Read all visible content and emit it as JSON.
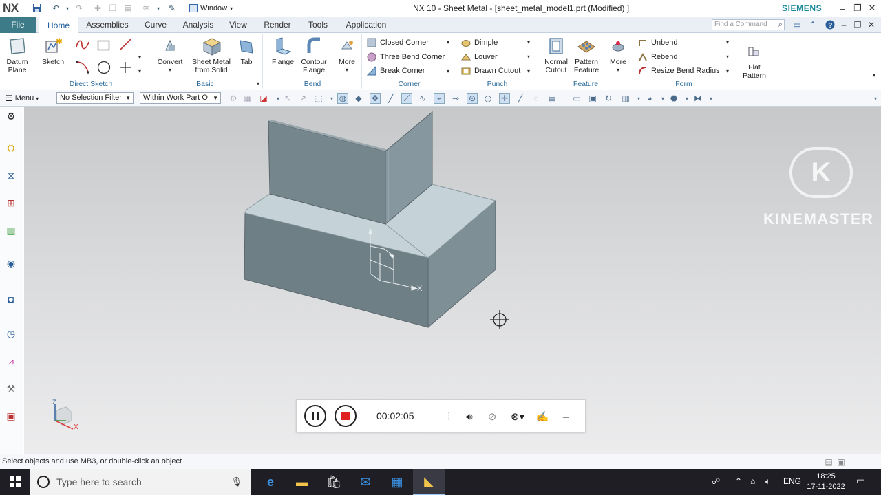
{
  "titlebar": {
    "logo": "NX",
    "window_menu": "Window",
    "title": "NX 10 - Sheet Metal - [sheet_metal_model1.prt (Modified) ]",
    "brand": "SIEMENS"
  },
  "tabs": {
    "file": "File",
    "items": [
      "Home",
      "Assemblies",
      "Curve",
      "Analysis",
      "View",
      "Render",
      "Tools",
      "Application"
    ],
    "active": "Home",
    "find_placeholder": "Find a Command"
  },
  "ribbon": {
    "datum_plane": "Datum Plane",
    "direct_sketch": {
      "sketch": "Sketch",
      "label": "Direct Sketch"
    },
    "basic": {
      "convert": "Convert",
      "sheet_metal_from_solid": "Sheet Metal from Solid",
      "tab": "Tab",
      "label": "Basic"
    },
    "bend": {
      "flange": "Flange",
      "contour_flange": "Contour Flange",
      "more": "More",
      "label": "Bend"
    },
    "corner": {
      "closed_corner": "Closed Corner",
      "three_bend_corner": "Three Bend Corner",
      "break_corner": "Break Corner",
      "label": "Corner"
    },
    "punch": {
      "dimple": "Dimple",
      "louver": "Louver",
      "drawn_cutout": "Drawn Cutout",
      "label": "Punch"
    },
    "feature": {
      "normal_cutout": "Normal Cutout",
      "pattern_feature": "Pattern Feature",
      "more": "More",
      "label": "Feature"
    },
    "form": {
      "unbend": "Unbend",
      "rebend": "Rebend",
      "resize_bend_radius": "Resize Bend Radius",
      "label": "Form"
    },
    "flat_pattern": "Flat Pattern"
  },
  "selbar": {
    "menu": "Menu",
    "selection_filter": "No Selection Filter",
    "scope": "Within Work Part O"
  },
  "viewport": {
    "watermark": "KINEMASTER",
    "triad_x": "X",
    "triad_z": "Z",
    "wcs_x": "X"
  },
  "recorder": {
    "time": "00:02:05"
  },
  "status": {
    "text": "Select objects and use MB3, or double-click an object"
  },
  "taskbar": {
    "search_placeholder": "Type here to search",
    "language": "ENG",
    "time": "18:25",
    "date": "17-11-2022"
  }
}
